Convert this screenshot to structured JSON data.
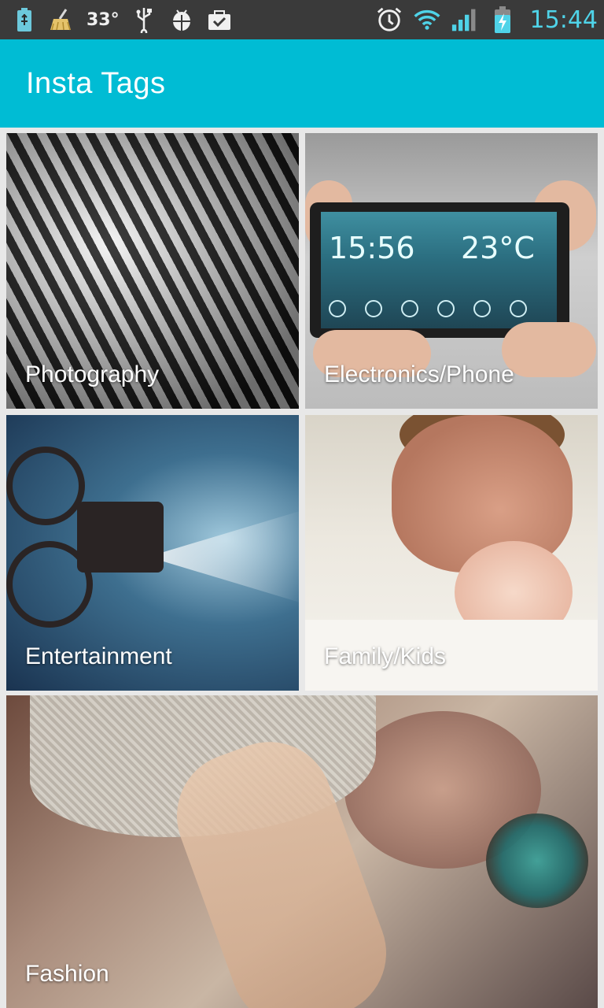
{
  "status_bar": {
    "temperature": "33°",
    "time": "15:44",
    "icons": [
      "battery-usb-icon",
      "cleaner-broom-icon",
      "usb-icon",
      "android-debug-icon",
      "clipboard-check-icon",
      "alarm-icon",
      "wifi-icon",
      "signal-icon",
      "battery-charging-icon"
    ],
    "clock_color": "#4fd3e8"
  },
  "appbar": {
    "title": "Insta Tags",
    "color": "#00bcd4"
  },
  "categories": [
    {
      "label": "Photography"
    },
    {
      "label": "Electronics/Phone"
    },
    {
      "label": "Entertainment"
    },
    {
      "label": "Family/Kids"
    },
    {
      "label": "Fashion"
    }
  ],
  "phone_screen": {
    "time": "15:56",
    "temp": "23°C"
  }
}
